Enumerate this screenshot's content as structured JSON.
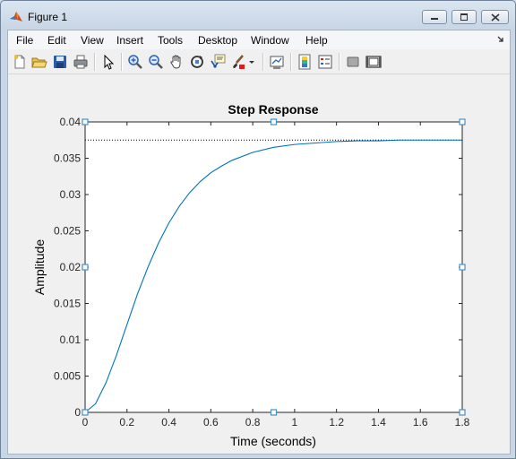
{
  "window": {
    "title": "Figure 1"
  },
  "menu": [
    "File",
    "Edit",
    "View",
    "Insert",
    "Tools",
    "Desktop",
    "Window",
    "Help"
  ],
  "toolbar_icons": [
    "new-figure-icon",
    "open-file-icon",
    "save-icon",
    "print-icon",
    "edit-plot-icon",
    "zoom-in-icon",
    "zoom-out-icon",
    "pan-icon",
    "rotate-3d-icon",
    "data-cursor-icon",
    "brush-icon",
    "brush-dropdown-icon",
    "link-plot-icon",
    "insert-colorbar-icon",
    "insert-legend-icon",
    "hide-plot-tools-icon",
    "show-plot-tools-icon"
  ],
  "chart_data": {
    "type": "line",
    "title": "Step Response",
    "xlabel": "Time (seconds)",
    "ylabel": "Amplitude",
    "xlim": [
      0,
      1.8
    ],
    "ylim": [
      0,
      0.04
    ],
    "xticks": [
      "0",
      "0.2",
      "0.4",
      "0.6",
      "0.8",
      "1",
      "1.2",
      "1.4",
      "1.6",
      "1.8"
    ],
    "yticks": [
      "0",
      "0.005",
      "0.01",
      "0.015",
      "0.02",
      "0.025",
      "0.03",
      "0.035",
      "0.04"
    ],
    "steady_state": 0.0375,
    "grid": false,
    "series": [
      {
        "color": "#0072bd",
        "x": [
          0,
          0.05,
          0.1,
          0.15,
          0.2,
          0.25,
          0.3,
          0.35,
          0.4,
          0.45,
          0.5,
          0.55,
          0.6,
          0.65,
          0.7,
          0.8,
          0.9,
          1.0,
          1.1,
          1.2,
          1.3,
          1.4,
          1.5,
          1.6,
          1.7,
          1.8
        ],
        "y": [
          0,
          0.0012,
          0.0041,
          0.0079,
          0.0121,
          0.0163,
          0.02,
          0.0233,
          0.0261,
          0.0284,
          0.0303,
          0.0318,
          0.033,
          0.0339,
          0.0347,
          0.0358,
          0.0365,
          0.0369,
          0.0371,
          0.0373,
          0.0374,
          0.0374,
          0.0375,
          0.0375,
          0.0375,
          0.0375
        ]
      }
    ],
    "steady_state_line": {
      "color": "#000000",
      "style": "dotted"
    },
    "selection_handle_color": "#4a90c8"
  }
}
